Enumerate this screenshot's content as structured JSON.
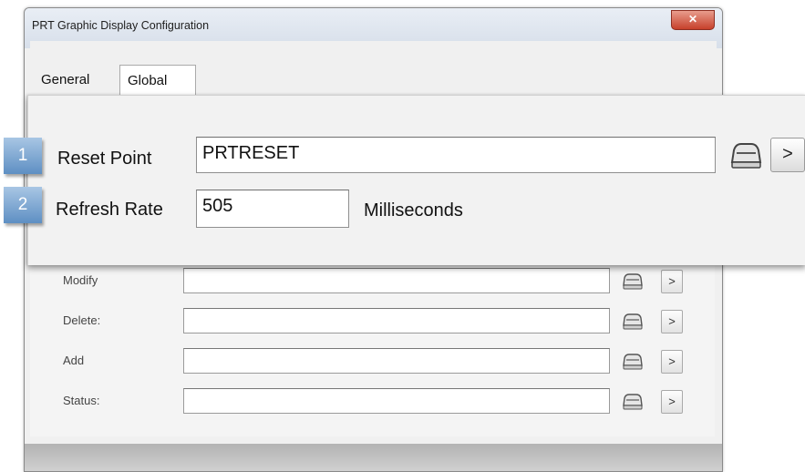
{
  "window": {
    "title": "PRT Graphic Display Configuration",
    "close_glyph": "✕"
  },
  "tabs": [
    {
      "label": "General",
      "active": false
    },
    {
      "label": "Global",
      "active": true
    }
  ],
  "callout": {
    "rows": [
      {
        "badge": "1",
        "label": "Reset Point",
        "value": "PRTRESET",
        "icon": "car-icon",
        "arrow": ">"
      },
      {
        "badge": "2",
        "label": "Refresh Rate",
        "value": "505",
        "unit": "Milliseconds"
      }
    ]
  },
  "background_rows": [
    {
      "label": "Modify",
      "value": "",
      "arrow": ">"
    },
    {
      "label": "Delete:",
      "value": "",
      "arrow": ">"
    },
    {
      "label": "Add",
      "value": "",
      "arrow": ">"
    },
    {
      "label": "Status:",
      "value": "",
      "arrow": ">"
    }
  ],
  "colors": {
    "badge_top": "#a8c6e4",
    "badge_bottom": "#5e8fc3",
    "close_button": "#c7402b"
  }
}
